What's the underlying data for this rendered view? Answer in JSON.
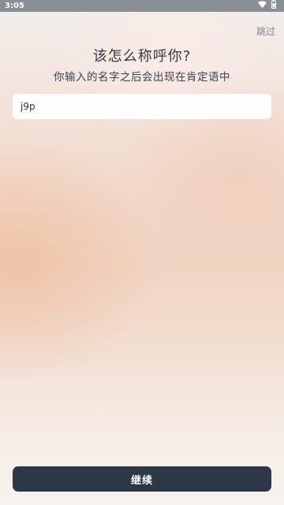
{
  "status_bar": {
    "time": "3:05",
    "icons": [
      "wifi-icon",
      "battery-icon"
    ]
  },
  "header": {
    "skip_label": "跳过"
  },
  "main": {
    "title": "该怎么称呼你?",
    "subtitle": "你输入的名字之后会出现在肯定语中",
    "name_input": {
      "value": "j9p"
    }
  },
  "footer": {
    "continue_label": "继续"
  },
  "colors": {
    "button_bg": "#2e3746",
    "status_bar_bg": "#8a8f93"
  }
}
